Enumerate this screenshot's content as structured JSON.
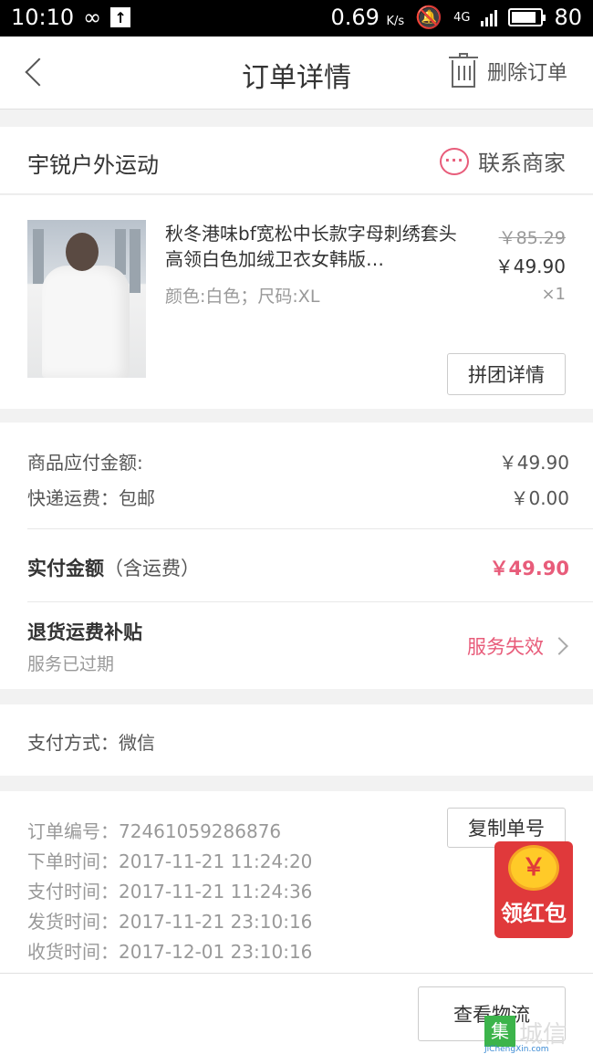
{
  "status_bar": {
    "time": "10:10",
    "speed": "0.69",
    "speed_unit": "K/s",
    "network": "4G",
    "battery": "80"
  },
  "header": {
    "title": "订单详情",
    "delete_label": "删除订单"
  },
  "shop": {
    "name": "宇锐户外运动",
    "contact_label": "联系商家"
  },
  "product": {
    "title": "秋冬港味bf宽松中长款字母刺绣套头高领白色加绒卫衣女韩版…",
    "spec": "颜色:白色；尺码:XL",
    "original_price": "￥85.29",
    "price": "￥49.90",
    "quantity": "×1",
    "group_button": "拼团详情"
  },
  "amounts": {
    "goods_label": "商品应付金额:",
    "goods_value": "￥49.90",
    "shipping_label": "快递运费：包邮",
    "shipping_value": "￥0.00",
    "total_label": "实付金额",
    "total_note": "（含运费）",
    "total_value": "￥49.90",
    "refund_title": "退货运费补贴",
    "refund_sub": "服务已过期",
    "refund_status": "服务失效"
  },
  "payment": {
    "text": "支付方式：微信"
  },
  "order_info": {
    "lines": [
      "订单编号：72461059286876",
      "下单时间：2017-11-21  11:24:20",
      "支付时间：2017-11-21  11:24:36",
      "发货时间：2017-11-21  23:10:16",
      "收货时间：2017-12-01  23:10:16"
    ],
    "copy_button": "复制单号"
  },
  "red_packet": {
    "coin_symbol": "￥",
    "label": "领红包"
  },
  "bottom": {
    "logistics_button": "查看物流"
  },
  "watermark": {
    "box": "集",
    "text": "城信",
    "sub": "JiChengXin.com"
  },
  "colors": {
    "accent": "#e85c7a",
    "red_packet": "#e0393b",
    "coin": "#ffca28"
  }
}
